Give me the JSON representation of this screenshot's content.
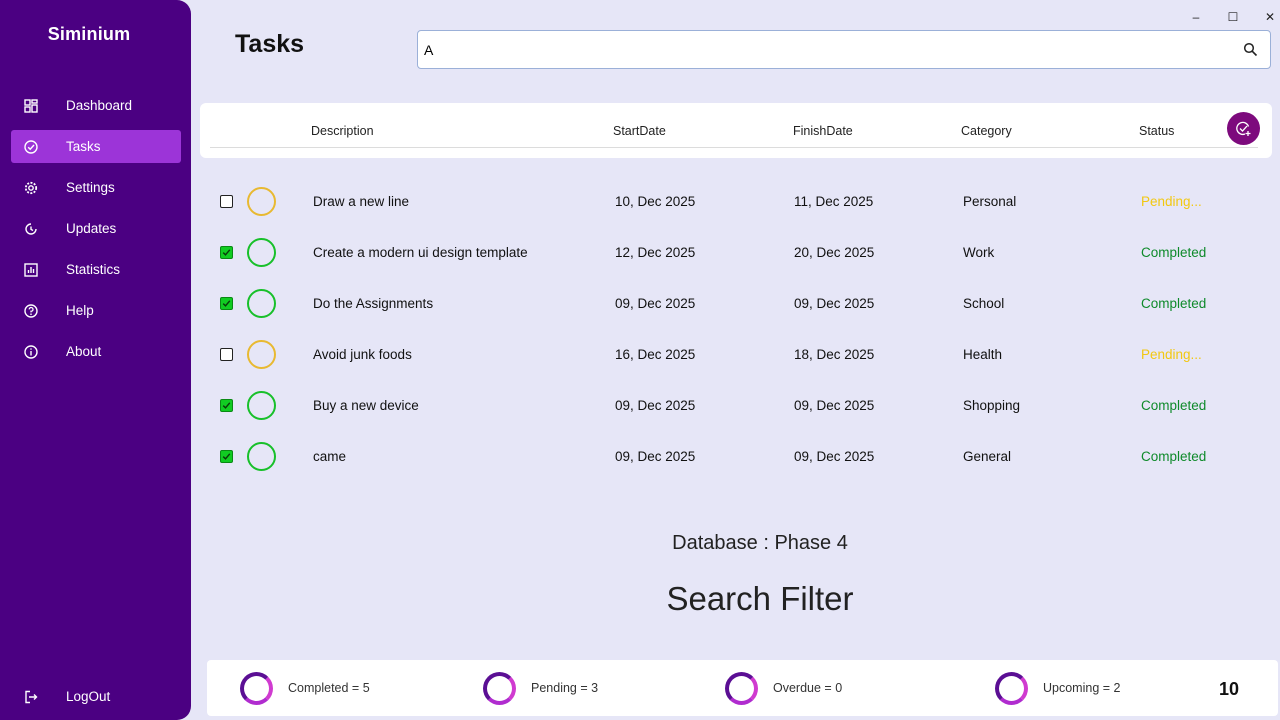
{
  "app": {
    "name": "Siminium"
  },
  "window_controls": {
    "minimize": "–",
    "maximize": "☐",
    "close": "✕"
  },
  "sidebar": {
    "items": [
      {
        "label": "Dashboard",
        "icon": "dashboard-icon"
      },
      {
        "label": "Tasks",
        "icon": "check-circle-icon",
        "active": true
      },
      {
        "label": "Settings",
        "icon": "gear-icon"
      },
      {
        "label": "Updates",
        "icon": "updates-icon"
      },
      {
        "label": "Statistics",
        "icon": "statistics-icon"
      },
      {
        "label": "Help",
        "icon": "help-icon"
      },
      {
        "label": "About",
        "icon": "info-icon"
      }
    ],
    "logout": {
      "label": "LogOut",
      "icon": "logout-icon"
    }
  },
  "header": {
    "title": "Tasks",
    "search": {
      "value": "A",
      "placeholder": ""
    }
  },
  "table": {
    "columns": [
      "Description",
      "StartDate",
      "FinishDate",
      "Category",
      "Status"
    ],
    "rows": [
      {
        "checked": false,
        "description": "Draw a new line",
        "start": "10, Dec 2025",
        "finish": "11, Dec 2025",
        "category": "Personal",
        "status": "Pending..."
      },
      {
        "checked": true,
        "description": "Create a modern ui design template",
        "start": "12, Dec 2025",
        "finish": "20, Dec 2025",
        "category": "Work",
        "status": "Completed"
      },
      {
        "checked": true,
        "description": "Do the Assignments",
        "start": "09, Dec 2025",
        "finish": "09, Dec 2025",
        "category": "School",
        "status": "Completed"
      },
      {
        "checked": false,
        "description": "Avoid junk foods",
        "start": "16, Dec 2025",
        "finish": "18, Dec 2025",
        "category": "Health",
        "status": "Pending..."
      },
      {
        "checked": true,
        "description": "Buy a new device",
        "start": "09, Dec 2025",
        "finish": "09, Dec 2025",
        "category": "Shopping",
        "status": "Completed"
      },
      {
        "checked": true,
        "description": "came",
        "start": "09, Dec 2025",
        "finish": "09, Dec 2025",
        "category": "General",
        "status": "Completed"
      }
    ]
  },
  "center": {
    "database_label": "Database : Phase 4",
    "filter_label": "Search Filter"
  },
  "footer": {
    "stats": [
      {
        "label": "Completed = 5"
      },
      {
        "label": "Pending = 3"
      },
      {
        "label": "Overdue = 0"
      },
      {
        "label": "Upcoming = 2"
      }
    ],
    "total": "10"
  },
  "colors": {
    "sidebar": "#4b0082",
    "active_nav": "#9c34d8",
    "background": "#e6e6f7",
    "pending": "#f2c811",
    "completed": "#0e8a2a",
    "accent_button": "#7d0a7d"
  }
}
